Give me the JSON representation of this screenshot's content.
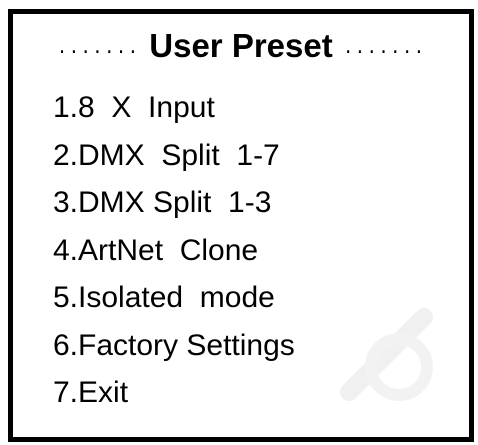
{
  "header": {
    "left_dots": ".......",
    "title": "User Preset",
    "right_dots": "......."
  },
  "menu": {
    "items": [
      {
        "label": "1.8  X  Input"
      },
      {
        "label": "2.DMX  Split  1-7"
      },
      {
        "label": "3.DMX Split  1-3"
      },
      {
        "label": "4.ArtNet  Clone"
      },
      {
        "label": "5.Isolated  mode"
      },
      {
        "label": "6.Factory Settings"
      },
      {
        "label": "7.Exit"
      }
    ]
  },
  "colors": {
    "background": "#ffffff",
    "text": "#000000",
    "border": "#000000"
  }
}
